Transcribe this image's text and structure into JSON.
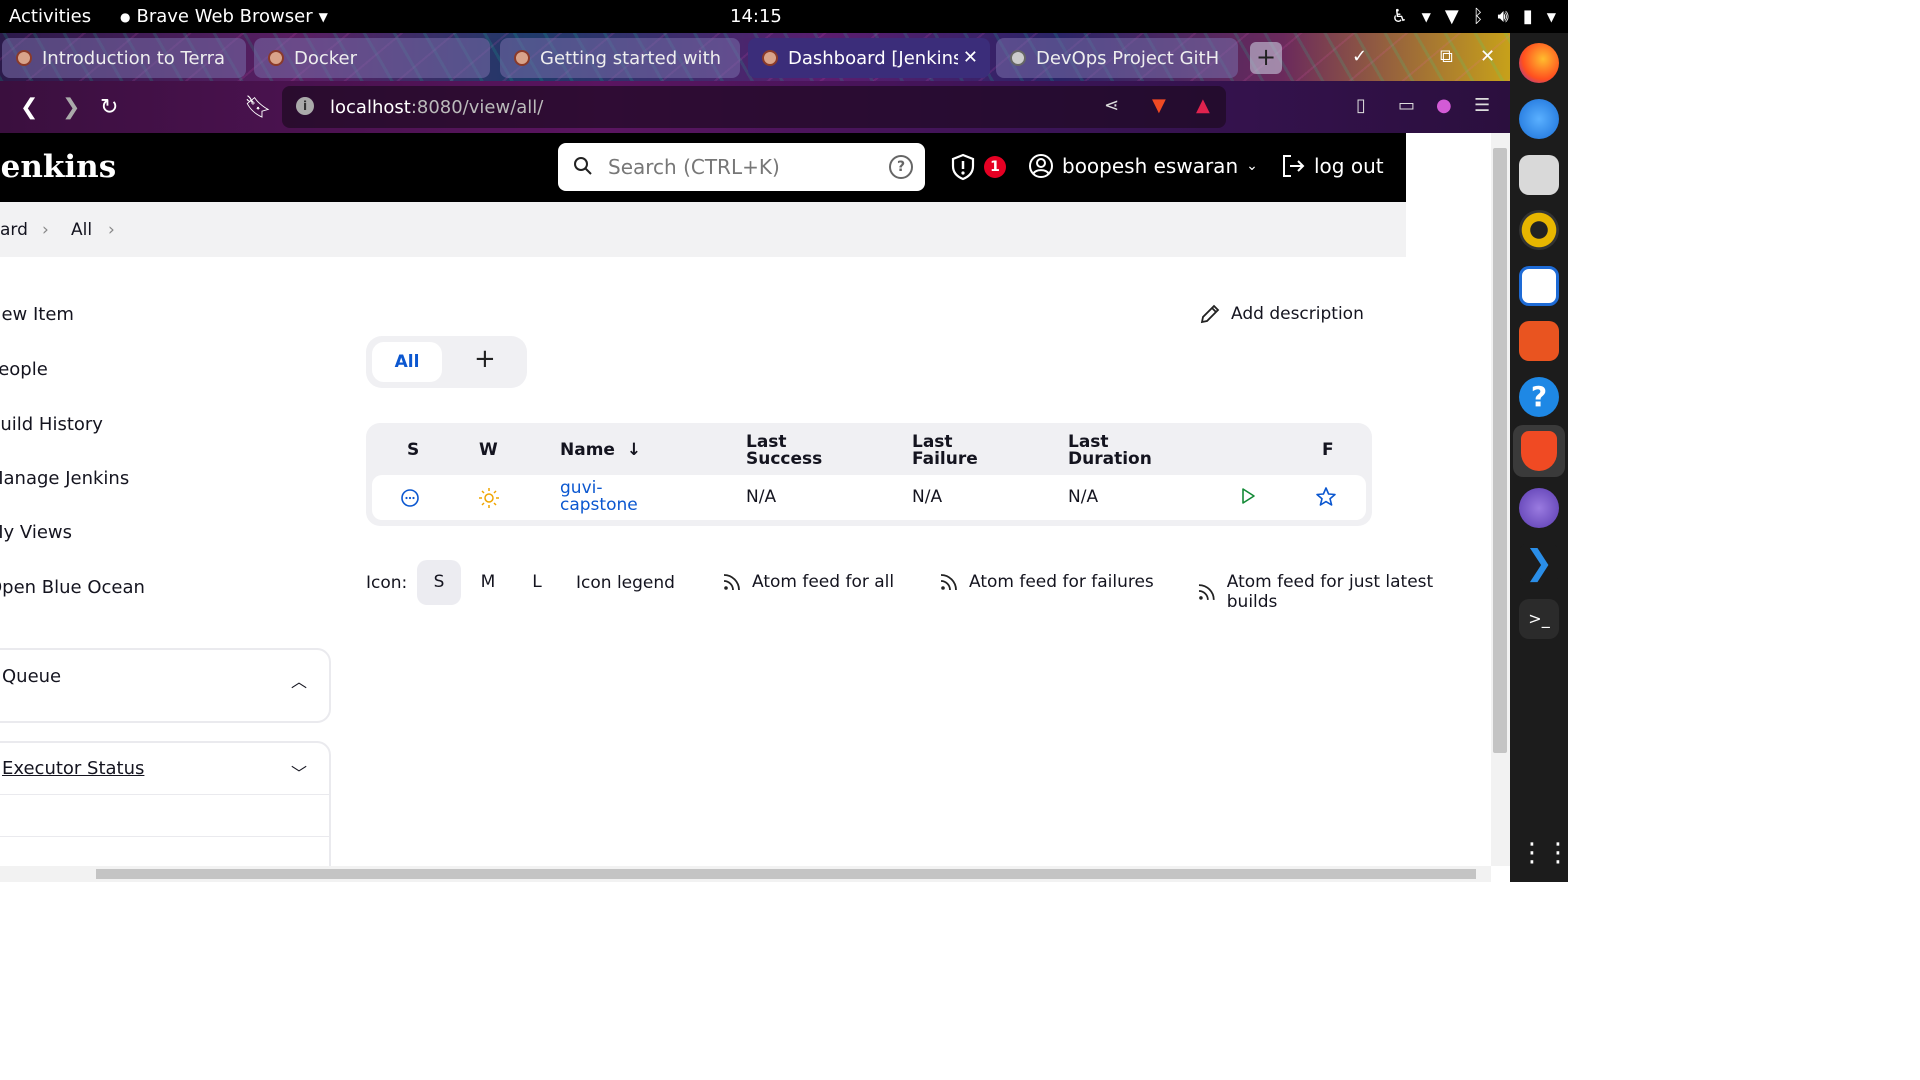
{
  "system": {
    "activities": "Activities",
    "app_name": "Brave Web Browser",
    "clock": "14:15"
  },
  "browser": {
    "tabs": [
      {
        "title": "Introduction to Terra"
      },
      {
        "title": "Docker"
      },
      {
        "title": "Getting started with"
      },
      {
        "title": "Dashboard [Jenkins"
      },
      {
        "title": "DevOps Project GitH"
      }
    ],
    "new_tab": "+",
    "url_host": "localhost",
    "url_rest": ":8080/view/all/"
  },
  "jenkins": {
    "brand": "Jenkins",
    "search_placeholder": "Search (CTRL+K)",
    "security_count": "1",
    "user": "boopesh eswaran",
    "logout": "log out",
    "breadcrumb": [
      "ard",
      "All"
    ],
    "sidebar": [
      "New Item",
      "People",
      "Build History",
      "Manage Jenkins",
      "My Views",
      "Open Blue Ocean"
    ],
    "queue_title": "Queue",
    "executor_title": "Executor Status",
    "add_description": "Add description",
    "view_tabs": {
      "all": "All",
      "add": "+"
    },
    "table": {
      "headers": {
        "s": "S",
        "w": "W",
        "name": "Name",
        "name_sort": "↓",
        "last_success": [
          "Last",
          "Success"
        ],
        "last_failure": [
          "Last",
          "Failure"
        ],
        "last_duration": [
          "Last",
          "Duration"
        ],
        "f": "F"
      },
      "rows": [
        {
          "name_line1": "guvi-",
          "name_line2": "capstone",
          "last_success": "N/A",
          "last_failure": "N/A",
          "last_duration": "N/A"
        }
      ]
    },
    "icon_bar": {
      "label": "Icon:",
      "sizes": [
        "S",
        "M",
        "L"
      ],
      "legend": "Icon legend",
      "feeds": [
        "Atom feed for all",
        "Atom feed for failures",
        "Atom feed for just latest builds"
      ]
    }
  }
}
